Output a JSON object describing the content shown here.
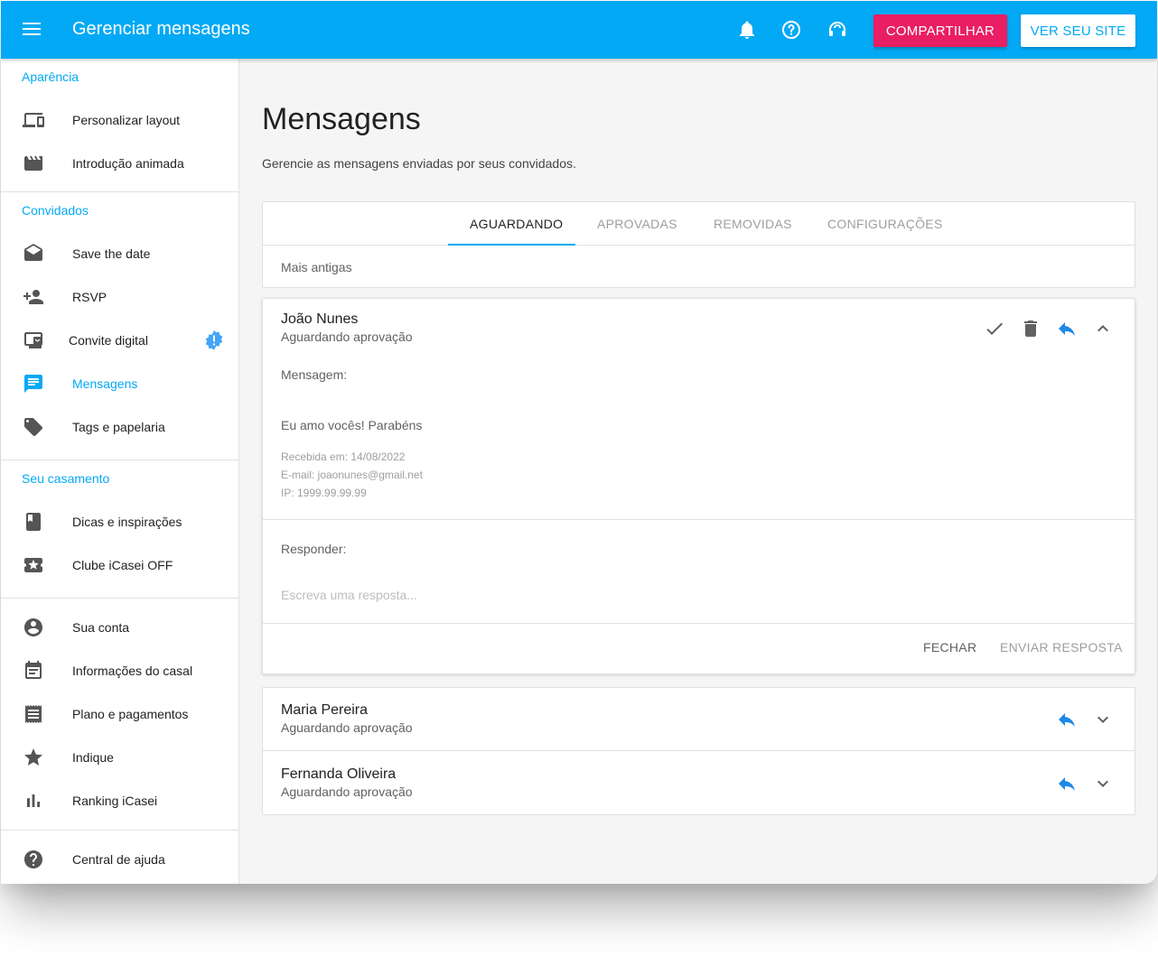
{
  "topbar": {
    "title": "Gerenciar mensagens",
    "share_label": "COMPARTILHAR",
    "site_label": "VER SEU SITE"
  },
  "colors": {
    "primary": "#03a9f4",
    "accent": "#e91e63"
  },
  "sidebar": {
    "sections": [
      {
        "header": "Aparência",
        "items": [
          {
            "label": "Personalizar layout",
            "icon": "devices-icon"
          },
          {
            "label": "Introdução animada",
            "icon": "movie-clapper-icon"
          }
        ]
      },
      {
        "header": "Convidados",
        "items": [
          {
            "label": "Save the date",
            "icon": "envelope-open-icon"
          },
          {
            "label": "RSVP",
            "icon": "person-add-icon"
          },
          {
            "label": "Convite digital",
            "icon": "digital-invite-icon"
          },
          {
            "label": "Mensagens",
            "icon": "message-icon"
          },
          {
            "label": "Tags e papelaria",
            "icon": "tag-icon"
          }
        ]
      },
      {
        "header": "Seu casamento",
        "items": [
          {
            "label": "Dicas e inspirações",
            "icon": "book-icon"
          },
          {
            "label": "Clube iCasei OFF",
            "icon": "ticket-icon"
          }
        ]
      },
      {
        "header": "",
        "items": [
          {
            "label": "Sua conta",
            "icon": "account-circle-icon"
          },
          {
            "label": "Informações do casal",
            "icon": "calendar-icon"
          },
          {
            "label": "Plano e pagamentos",
            "icon": "receipt-icon"
          },
          {
            "label": "Indique",
            "icon": "star-icon"
          },
          {
            "label": "Ranking iCasei",
            "icon": "bar-chart-icon"
          }
        ]
      },
      {
        "header": "",
        "items": [
          {
            "label": "Central de ajuda",
            "icon": "help-icon"
          }
        ]
      }
    ]
  },
  "main": {
    "title": "Mensagens",
    "subtitle": "Gerencie as mensagens enviadas por seus convidados.",
    "tabs": [
      {
        "label": "AGUARDANDO",
        "active": true
      },
      {
        "label": "APROVADAS",
        "active": false
      },
      {
        "label": "REMOVIDAS",
        "active": false
      },
      {
        "label": "CONFIGURAÇÕES",
        "active": false
      }
    ],
    "sort_label": "Mais antigas",
    "expanded": {
      "name": "João Nunes",
      "status": "Aguardando aprovação",
      "message_label": "Mensagem:",
      "message": "Eu amo vocês! Parabéns",
      "received": "Recebida em: 14/08/2022",
      "email": "E-mail: joaonunes@gmail.net",
      "ip": "IP: 1999.99.99.99",
      "reply_label": "Responder:",
      "reply_placeholder": "Escreva uma resposta...",
      "close_label": "FECHAR",
      "send_label": "ENVIAR RESPOSTA"
    },
    "messages": [
      {
        "name": "Maria Pereira",
        "status": "Aguardando aprovação"
      },
      {
        "name": "Fernanda Oliveira",
        "status": "Aguardando aprovação"
      }
    ]
  }
}
